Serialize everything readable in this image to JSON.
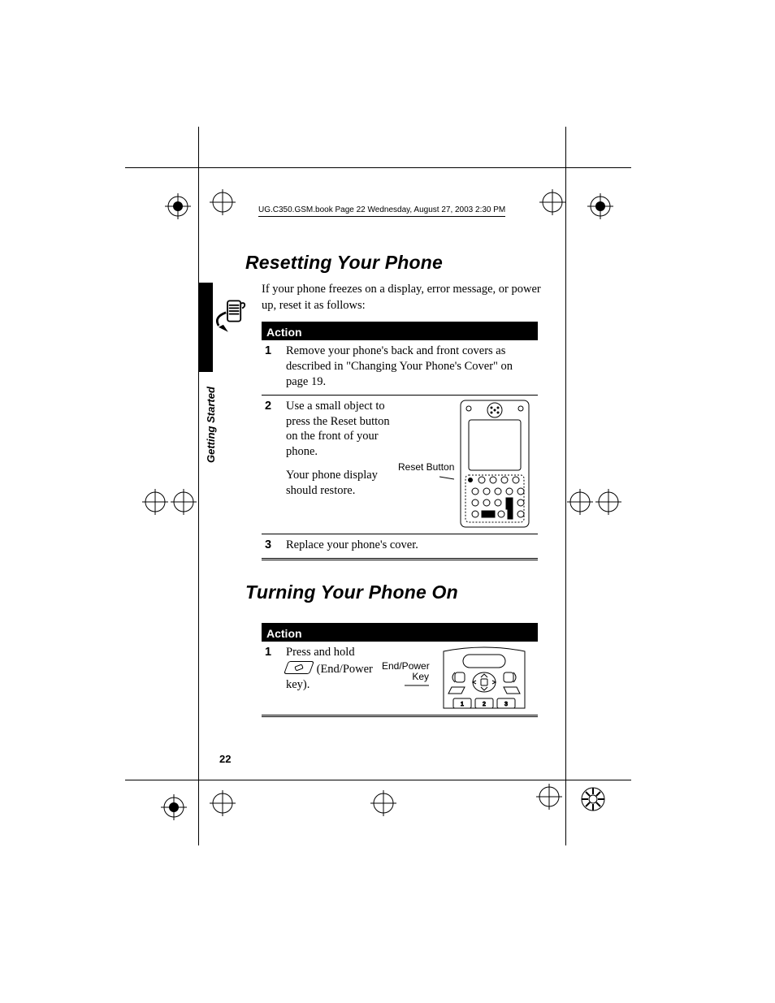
{
  "running_head": "UG.C350.GSM.book  Page 22  Wednesday, August 27, 2003  2:30 PM",
  "sidebar_label": "Getting Started",
  "page_number": "22",
  "section1": {
    "heading": "Resetting Your Phone",
    "intro": "If your phone freezes on a display, error message, or power up, reset it as follows:",
    "action_header": "Action",
    "steps": [
      {
        "num": "1",
        "text": "Remove your phone's back and front covers as described in \"Changing Your Phone's Cover\" on page 19."
      },
      {
        "num": "2",
        "text_a": "Use a small object to press the Reset button on the front of your phone.",
        "text_b": "Your phone display should restore.",
        "callout": "Reset Button"
      },
      {
        "num": "3",
        "text": "Replace your phone's cover."
      }
    ]
  },
  "section2": {
    "heading": "Turning Your Phone On",
    "action_header": "Action",
    "steps": [
      {
        "num": "1",
        "text_prefix": "Press and hold",
        "key_label": "(End/Power key).",
        "callout": "End/Power Key"
      }
    ]
  }
}
